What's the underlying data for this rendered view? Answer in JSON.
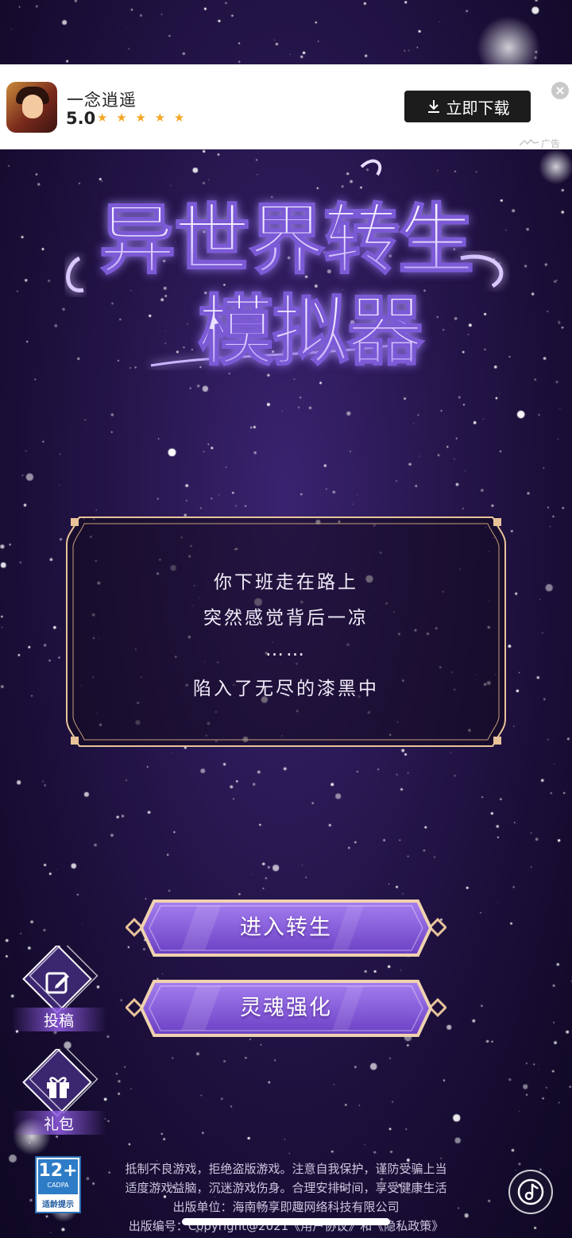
{
  "ad": {
    "app_name": "一念逍遥",
    "rating": "5.0",
    "stars": "★ ★ ★ ★ ★",
    "download_label": "立即下载",
    "ad_tag": "广告"
  },
  "game": {
    "title_line1": "异世界转生",
    "title_line2": "模拟器"
  },
  "story": {
    "lines": [
      "你下班走在路上",
      "突然感觉背后一凉",
      "……",
      "陷入了无尽的漆黑中"
    ]
  },
  "menu": {
    "enter_label": "进入转生",
    "soul_label": "灵魂强化"
  },
  "side": {
    "submit_label": "投稿",
    "gift_label": "礼包"
  },
  "footer": {
    "age_rating": "12+",
    "age_org": "CADPA",
    "age_text": "适龄提示",
    "line1": "抵制不良游戏，拒绝盗版游戏。注意自我保护，谨防受骗上当",
    "line2": "适度游戏益脑，沉迷游戏伤身。合理安排时间，享受健康生活",
    "line3": "出版单位：海南畅享即趣网络科技有限公司",
    "line4": "出版编号：Copyright@2021《用户协议》和《隐私政策》"
  },
  "colors": {
    "bg_top": "#3a2370",
    "bg_bottom": "#0f0823",
    "button_purple": "#8b5fd6",
    "gold_border": "#e8c39a",
    "ad_button": "#1c1c1c"
  }
}
